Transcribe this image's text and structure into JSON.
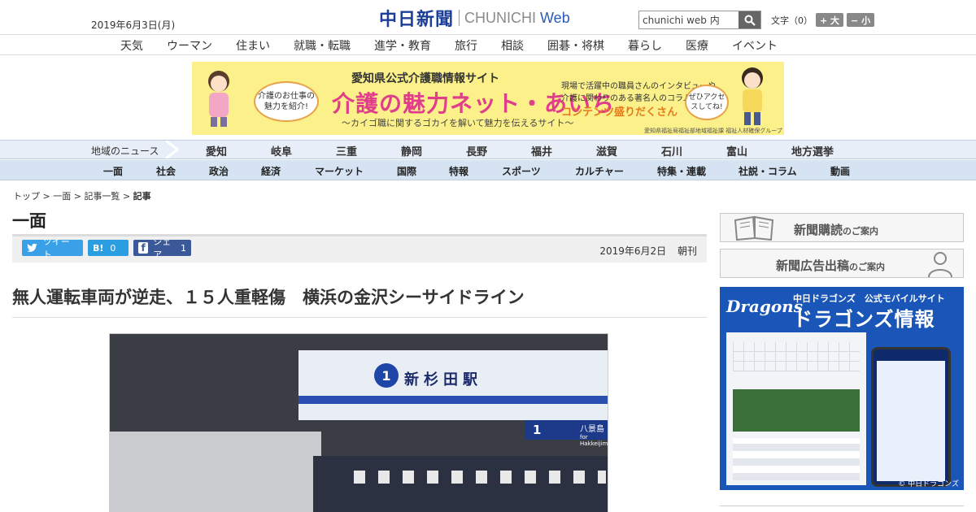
{
  "header": {
    "date": "2019年6月3日(月)",
    "logo_ja": "中日新聞",
    "logo_en": "CHUNICHI",
    "logo_web": "Web",
    "search_value": "chunichi web 内",
    "font_label": "文字（0）",
    "font_larger": "+ 大",
    "font_smaller": "− 小"
  },
  "topnav": [
    "天気",
    "ウーマン",
    "住まい",
    "就職・転職",
    "進学・教育",
    "旅行",
    "相談",
    "囲碁・将棋",
    "暮らし",
    "医療",
    "イベント"
  ],
  "banner": {
    "sub": "愛知県公式介護職情報サイト",
    "main": "介護の魅力ネット・あいち",
    "tag": "〜カイゴ職に関するゴカイを解いて魅力を伝えるサイト〜",
    "bubble_left": "介護のお仕事の魅力を紹介!",
    "bubble_right": "ぜひアクセスしてね!",
    "right_line1": "現場で活躍中の職員さんのインタビューや",
    "right_line2": "介護に関わりのある著名人のコラムなど",
    "right_bold": "コンテンツ盛りだくさん",
    "footnote": "愛知県福祉局福祉部地域福祉課 福祉人材確保グループ"
  },
  "regionnav": {
    "label": "地域のニュース",
    "items": [
      "愛知",
      "岐阜",
      "三重",
      "静岡",
      "長野",
      "福井",
      "滋賀",
      "石川",
      "富山",
      "地方選挙"
    ]
  },
  "genrenav": [
    "一面",
    "社会",
    "政治",
    "経済",
    "マーケット",
    "国際",
    "特報",
    "スポーツ",
    "カルチャー",
    "特集・連載",
    "社説・コラム",
    "動画"
  ],
  "breadcrumb": {
    "items": [
      "トップ",
      "一面",
      "記事一覧"
    ],
    "separator": ">",
    "current": "記事"
  },
  "section_title": "一面",
  "share": {
    "tweet": "ツイート",
    "hatena_mark": "B!",
    "hatena_count": "0",
    "facebook": "シェア",
    "facebook_count": "1",
    "article_date": "2019年6月2日",
    "edition": "朝刊"
  },
  "headline": "無人運転車両が逆走、１５人重軽傷　横浜の金沢シーサイドライン",
  "photo": {
    "station_number": "1",
    "station_name": "新杉田駅",
    "platform_number": "1",
    "platform_dest": "八景島",
    "platform_dest_en": "for Hakkeijima"
  },
  "sidebar": {
    "subscribe": "新聞購読",
    "subscribe_small": "のご案内",
    "ads": "新聞広告出稿",
    "ads_small": "のご案内",
    "dragons_brand": "Dragons",
    "dragons_sub": "中日ドラゴンズ　公式モバイルサイト",
    "dragons_title": "ドラゴンズ情報",
    "dragons_copy": "© 中日ドラゴンズ"
  },
  "colors": {
    "brand_blue": "#1b3e96",
    "region_bg": "#e8eef7",
    "genre_bg": "#d5e3f3",
    "twitter": "#3aa1e8",
    "hatena": "#2a9ee0",
    "facebook": "#3b5998",
    "banner_bg": "#fbf08a",
    "banner_pink": "#e03d8b"
  }
}
